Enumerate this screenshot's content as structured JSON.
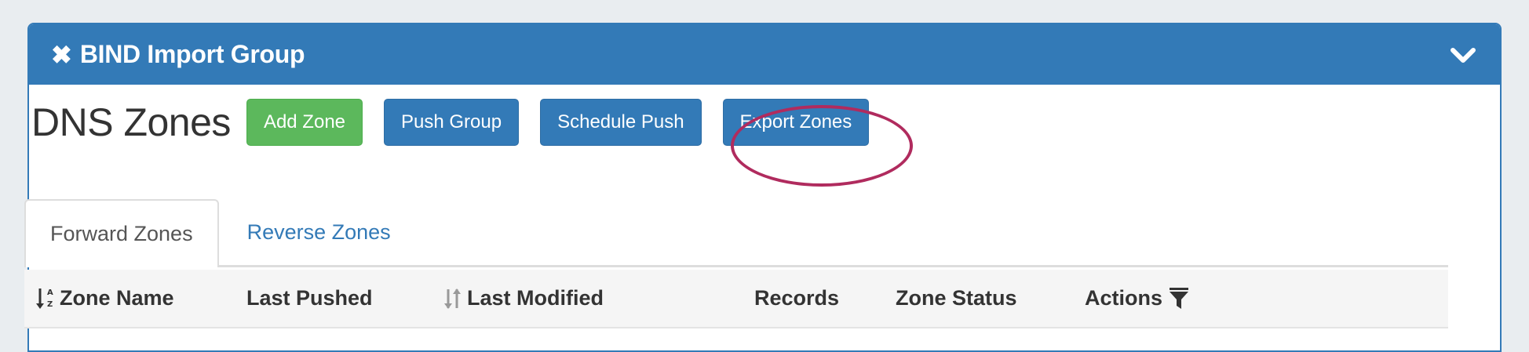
{
  "panel": {
    "close_icon": "✖",
    "title": "BIND Import Group",
    "collapse_icon": "chevron-down-icon",
    "header_color": "#337ab7"
  },
  "toolbar": {
    "page_title": "DNS Zones",
    "add_zone": "Add Zone",
    "push_group": "Push Group",
    "schedule_push": "Schedule Push",
    "export_zones": "Export Zones",
    "success_color": "#5cb85c",
    "primary_color": "#337ab7",
    "highlight_color": "#b02b5e"
  },
  "tabs": {
    "forward": "Forward Zones",
    "reverse": "Reverse Zones",
    "active": "Forward Zones"
  },
  "table": {
    "columns": {
      "zone_name": "Zone Name",
      "last_pushed": "Last Pushed",
      "last_modified": "Last Modified",
      "records": "Records",
      "zone_status": "Zone Status",
      "actions": "Actions"
    },
    "icons": {
      "zone_name_sort": "sort-alpha-asc-icon",
      "last_modified_sort": "sort-icon",
      "actions_filter": "filter-icon"
    }
  }
}
